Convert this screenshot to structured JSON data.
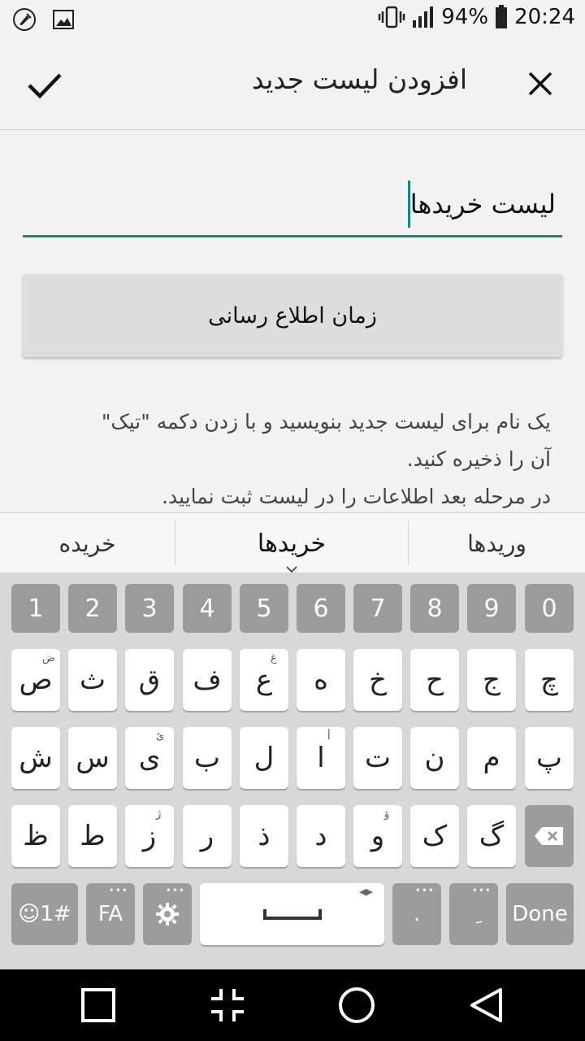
{
  "status_bar": {
    "battery": "94%",
    "time": "20:24",
    "icons": [
      "cleaner-icon",
      "image-icon",
      "vibrate-icon",
      "signal-icon",
      "battery-icon"
    ]
  },
  "app_bar": {
    "title": "افزودن لیست جدید",
    "confirm_icon": "check-icon",
    "close_icon": "close-icon"
  },
  "form": {
    "list_name_value": "لیست خریدها",
    "notify_button_label": "زمان اطلاع رسانی",
    "help_lines": [
      "یک نام برای لیست جدید بنویسید و با زدن دکمه \"تیک\"",
      "آن را ذخیره کنید.",
      "در مرحله بعد اطلاعات را در لیست ثبت نمایید."
    ]
  },
  "suggestions": {
    "left": "خریده",
    "center": "خریدها",
    "right": "وریدها"
  },
  "keyboard": {
    "numbers": [
      "1",
      "2",
      "3",
      "4",
      "5",
      "6",
      "7",
      "8",
      "9",
      "0"
    ],
    "row1": [
      "ص",
      "ث",
      "ق",
      "ف",
      "ع",
      "ه",
      "خ",
      "ح",
      "ج",
      "چ"
    ],
    "row1_hints": [
      "ض",
      "",
      "",
      "",
      "غ",
      "",
      "",
      "",
      "",
      ""
    ],
    "row2": [
      "ش",
      "س",
      "ی",
      "ب",
      "ل",
      "ا",
      "ت",
      "ن",
      "م",
      "پ"
    ],
    "row2_hints": [
      "",
      "",
      "ئ",
      "",
      "",
      "أ",
      "",
      "",
      "",
      ""
    ],
    "row3": [
      "ظ",
      "ط",
      "ز",
      "ر",
      "ذ",
      "د",
      "و",
      "ک",
      "گ"
    ],
    "row3_hints": [
      "",
      "",
      "ژ",
      "",
      "",
      "",
      "ؤ",
      "",
      "",
      ""
    ],
    "symbols_label": "☺1#",
    "lang_label": "FA",
    "period_label": ".",
    "kasra_label": "ِ",
    "done_label": "Done"
  },
  "colors": {
    "accent": "#0f8a7c",
    "key_dark": "#9b9b9b",
    "keyboard_bg": "#d7d8da"
  }
}
